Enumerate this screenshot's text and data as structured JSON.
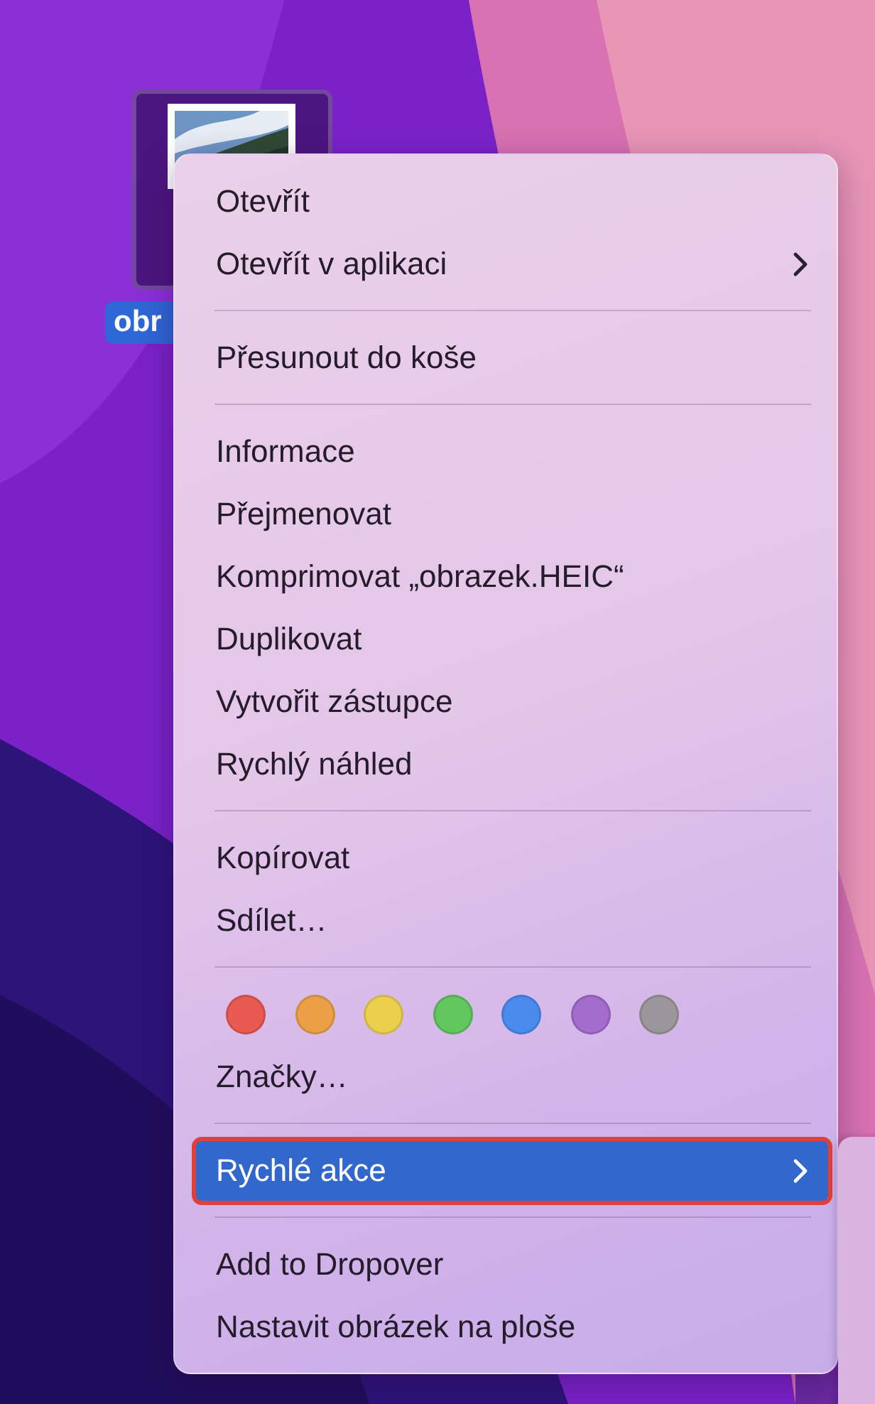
{
  "desktop_file": {
    "label": "obr",
    "selected": true
  },
  "menu": {
    "sections": [
      {
        "kind": "items",
        "items": [
          {
            "label": "Otevřít",
            "submenu": false,
            "selected": false,
            "highlighted": false
          },
          {
            "label": "Otevřít v aplikaci",
            "submenu": true,
            "selected": false,
            "highlighted": false
          }
        ]
      },
      {
        "kind": "items",
        "items": [
          {
            "label": "Přesunout do koše",
            "submenu": false,
            "selected": false,
            "highlighted": false
          }
        ]
      },
      {
        "kind": "items",
        "items": [
          {
            "label": "Informace",
            "submenu": false,
            "selected": false,
            "highlighted": false
          },
          {
            "label": "Přejmenovat",
            "submenu": false,
            "selected": false,
            "highlighted": false
          },
          {
            "label": "Komprimovat „obrazek.HEIC“",
            "submenu": false,
            "selected": false,
            "highlighted": false
          },
          {
            "label": "Duplikovat",
            "submenu": false,
            "selected": false,
            "highlighted": false
          },
          {
            "label": "Vytvořit zástupce",
            "submenu": false,
            "selected": false,
            "highlighted": false
          },
          {
            "label": "Rychlý náhled",
            "submenu": false,
            "selected": false,
            "highlighted": false
          }
        ]
      },
      {
        "kind": "items",
        "items": [
          {
            "label": "Kopírovat",
            "submenu": false,
            "selected": false,
            "highlighted": false
          },
          {
            "label": "Sdílet…",
            "submenu": false,
            "selected": false,
            "highlighted": false
          }
        ]
      },
      {
        "kind": "tags",
        "tags": [
          {
            "color": "#e85a52"
          },
          {
            "color": "#eba047"
          },
          {
            "color": "#eccf4d"
          },
          {
            "color": "#62c75f"
          },
          {
            "color": "#4a8cee"
          },
          {
            "color": "#a46ccd"
          },
          {
            "color": "#9b9699"
          }
        ],
        "items": [
          {
            "label": "Značky…",
            "submenu": false,
            "selected": false,
            "highlighted": false
          }
        ]
      },
      {
        "kind": "items",
        "items": [
          {
            "label": "Rychlé akce",
            "submenu": true,
            "selected": true,
            "highlighted": true
          }
        ]
      },
      {
        "kind": "items",
        "items": [
          {
            "label": "Add to Dropover",
            "submenu": false,
            "selected": false,
            "highlighted": false
          },
          {
            "label": "Nastavit obrázek na ploše",
            "submenu": false,
            "selected": false,
            "highlighted": false
          }
        ]
      }
    ]
  },
  "submenu": {
    "open": true
  }
}
